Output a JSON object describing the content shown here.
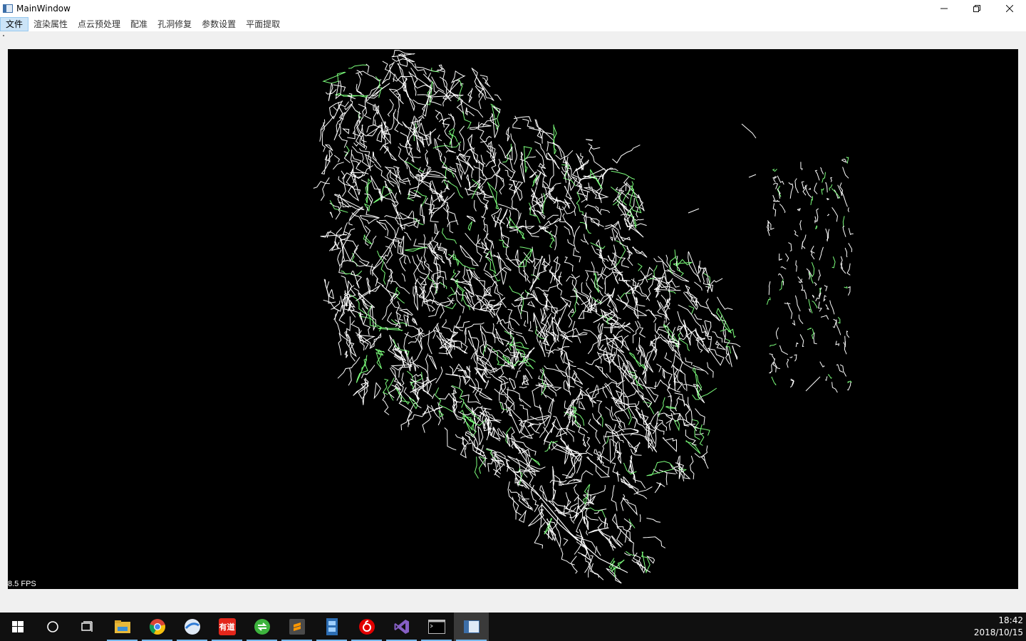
{
  "window": {
    "title": "MainWindow",
    "controls": {
      "minimize": "minimize",
      "restore": "restore",
      "close": "close"
    }
  },
  "menu": {
    "items": [
      {
        "label": "文件",
        "active": true
      },
      {
        "label": "渲染属性"
      },
      {
        "label": "点云预处理"
      },
      {
        "label": "配准"
      },
      {
        "label": "孔洞修复"
      },
      {
        "label": "参数设置"
      },
      {
        "label": "平面提取"
      }
    ]
  },
  "viewport": {
    "background": "#000000",
    "line_color": "#ffffff",
    "accent_color": "#7cff7c",
    "fps": "8.5 FPS"
  },
  "taskbar": {
    "icons": [
      {
        "name": "start-icon"
      },
      {
        "name": "search-circle-icon"
      },
      {
        "name": "task-view-icon"
      },
      {
        "name": "file-explorer-icon",
        "running": true
      },
      {
        "name": "chrome-icon",
        "running": true
      },
      {
        "name": "browser-icon",
        "running": true
      },
      {
        "name": "youdao-icon",
        "label": "有道",
        "running": true
      },
      {
        "name": "green-app-icon",
        "running": true
      },
      {
        "name": "sublime-icon",
        "running": true
      },
      {
        "name": "film-app-icon",
        "running": true
      },
      {
        "name": "netease-music-icon",
        "running": true
      },
      {
        "name": "visual-studio-icon",
        "running": true
      },
      {
        "name": "console-icon",
        "running": true
      },
      {
        "name": "mainwindow-app-icon",
        "running": true,
        "active": true
      }
    ],
    "clock": {
      "time": "18:42",
      "date": "2018/10/15"
    }
  }
}
